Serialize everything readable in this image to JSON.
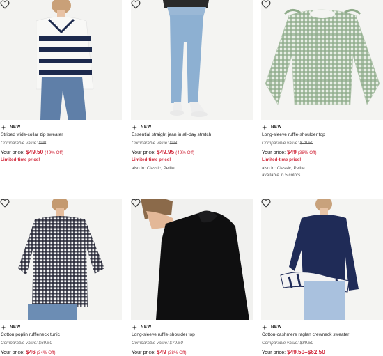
{
  "products": [
    {
      "badge": "NEW",
      "name": "Striped wide-collar zip sweater",
      "comparable_label": "Comparable value:",
      "comparable_value": "$98",
      "price_label": "Your price:",
      "price": "$49.50",
      "discount": "(49% Off)",
      "promo": "Limited-time price!",
      "also_in": "",
      "colors": ""
    },
    {
      "badge": "NEW",
      "name": "Essential straight jean in all-day stretch",
      "comparable_label": "Comparable value:",
      "comparable_value": "$98",
      "price_label": "Your price:",
      "price": "$49.95",
      "discount": "(49% Off)",
      "promo": "Limited-time price!",
      "also_in": "also in: Classic, Petite",
      "colors": ""
    },
    {
      "badge": "NEW",
      "name": "Long-sleeve ruffle-shoulder top",
      "comparable_label": "Comparable value:",
      "comparable_value": "$79.50",
      "price_label": "Your price:",
      "price": "$49",
      "discount": "(38% Off)",
      "promo": "Limited-time price!",
      "also_in": "also in: Classic, Petite",
      "colors": "available in 5 colors"
    },
    {
      "badge": "NEW",
      "name": "Cotton poplin ruffleneck tunic",
      "comparable_label": "Comparable value:",
      "comparable_value": "$69.50",
      "price_label": "Your price:",
      "price": "$46",
      "discount": "(34% Off)",
      "promo": "",
      "also_in": "",
      "colors": ""
    },
    {
      "badge": "NEW",
      "name": "Long-sleeve ruffle-shoulder top",
      "comparable_label": "Comparable value:",
      "comparable_value": "$79.50",
      "price_label": "Your price:",
      "price": "$49",
      "discount": "(38% Off)",
      "promo": "",
      "also_in": "",
      "colors": ""
    },
    {
      "badge": "NEW",
      "name": "Cotton-cashmere raglan crewneck sweater",
      "comparable_label": "Comparable value:",
      "comparable_value": "$89.50",
      "price_label": "Your price:",
      "price": "$49.50–$62.50",
      "discount": "",
      "promo": "",
      "also_in": "",
      "colors": ""
    }
  ],
  "icons": {
    "wishlist": "heart-outline-icon",
    "new_badge": "sparkle-icon"
  },
  "colors": {
    "sale_red": "#d1293b",
    "text": "#222222",
    "muted": "#666666"
  }
}
